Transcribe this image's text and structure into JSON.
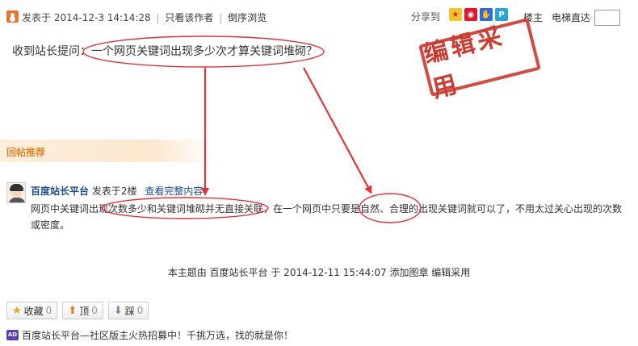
{
  "post_meta": {
    "posted_label": "发表于",
    "posted_time": "2014-12-3 14:14:28",
    "only_author": "只看该作者",
    "reverse_view": "倒序浏览"
  },
  "share": {
    "label": "分享到",
    "icons": [
      "qzone-icon",
      "weibo-icon",
      "baidu-icon",
      "qq-icon"
    ]
  },
  "nav": {
    "floor_owner": "楼主",
    "goto_floor": "电梯直达",
    "goto_value": ""
  },
  "question": "收到站长提问：一个网页关键词出现多少次才算关键词堆砌？",
  "stamp": "编辑采用",
  "recommend_title": "回帖推荐",
  "reply": {
    "author": "百度站长平台",
    "posted": "发表于2楼",
    "view_full": "查看完整内容",
    "body": "网页中关键词出现次数多少和关键词堆砌并无直接关联，在一个网页中只要是自然、合理的出现关键词就可以了，不用太过关心出现的次数或密度。"
  },
  "edit_note": "本主题由 百度站长平台 于 2014-12-11 15:44:07 添加图章 编辑采用",
  "actions": [
    {
      "label": "收藏",
      "count": "0"
    },
    {
      "label": "顶",
      "count": "0"
    },
    {
      "label": "踩",
      "count": "0"
    }
  ],
  "ad": {
    "badge": "AD",
    "text": "百度站长平台—社区版主火热招募中！千挑万选，找的就是你！"
  },
  "colors": {
    "annotation_red": "#e8323b",
    "link_blue": "#1d4d8b",
    "reco_orange": "#e08a2c"
  }
}
